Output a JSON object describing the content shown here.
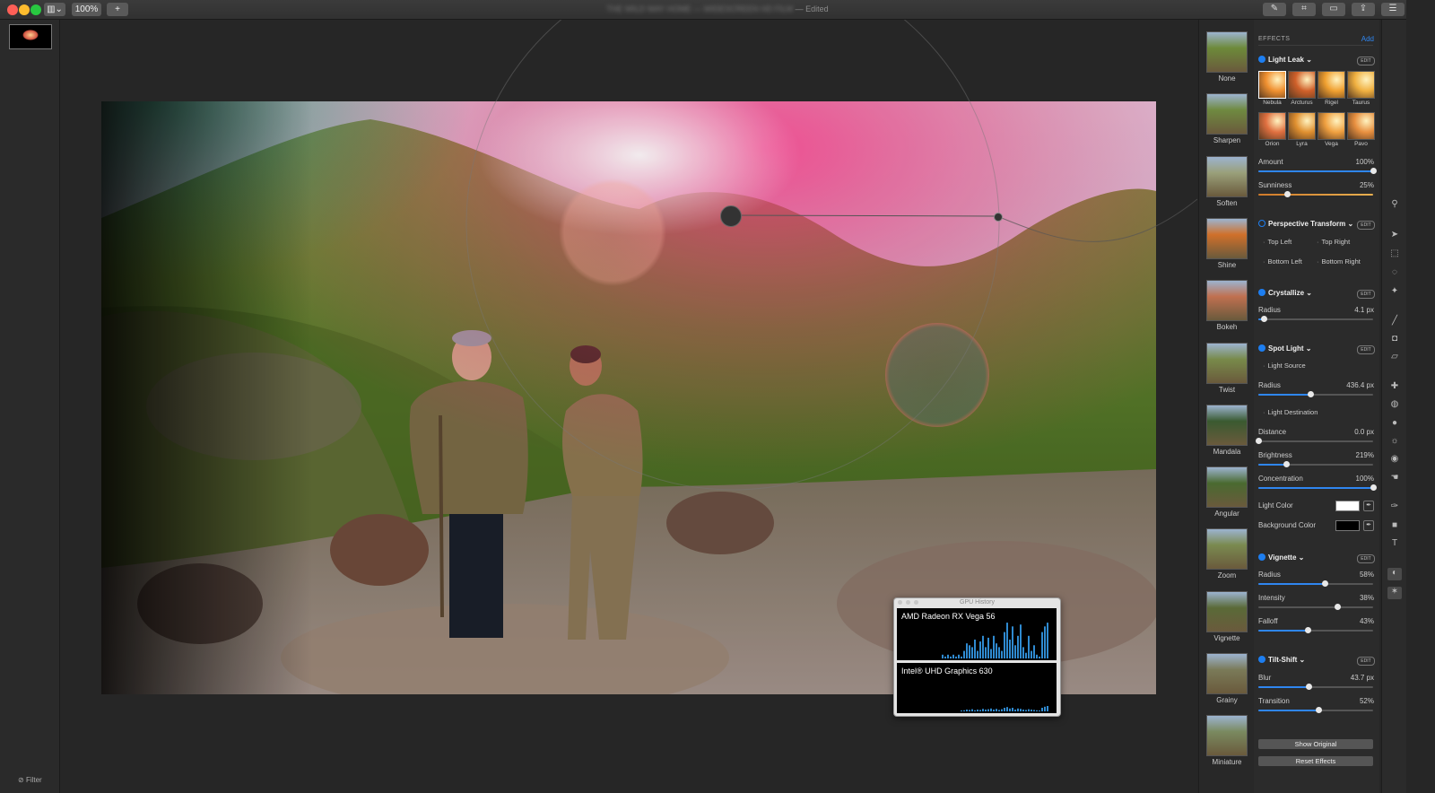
{
  "titlebar": {
    "view_button": "▥⌄",
    "zoom": "100%",
    "add_label": "+",
    "document_title": "THE WILD WAY HOME — WIDESCREEN HD FILM",
    "edited_label": "— Edited"
  },
  "sidebar_left": {
    "filter_label": "Filter"
  },
  "gpu_history": {
    "title": "GPU History",
    "gpus": [
      {
        "name": "AMD Radeon RX Vega 56",
        "bars": [
          0.1,
          0.05,
          0.1,
          0.05,
          0.1,
          0.05,
          0.1,
          0.05,
          0.2,
          0.4,
          0.35,
          0.3,
          0.5,
          0.2,
          0.45,
          0.6,
          0.3,
          0.55,
          0.25,
          0.6,
          0.4,
          0.3,
          0.2,
          0.7,
          0.95,
          0.5,
          0.85,
          0.35,
          0.6,
          0.9,
          0.3,
          0.15,
          0.6,
          0.2,
          0.35,
          0.1,
          0.05,
          0.7,
          0.85,
          0.95
        ]
      },
      {
        "name": "Intel® UHD Graphics 630",
        "bars": [
          0.0,
          0.0,
          0.0,
          0.0,
          0.0,
          0.0,
          0.0,
          0.02,
          0.03,
          0.05,
          0.04,
          0.06,
          0.03,
          0.05,
          0.04,
          0.07,
          0.05,
          0.06,
          0.08,
          0.05,
          0.07,
          0.04,
          0.06,
          0.1,
          0.12,
          0.08,
          0.1,
          0.05,
          0.08,
          0.07,
          0.05,
          0.04,
          0.06,
          0.05,
          0.04,
          0.03,
          0.02,
          0.1,
          0.13,
          0.15
        ]
      }
    ]
  },
  "effect_list": [
    "None",
    "Sharpen",
    "Soften",
    "Shine",
    "Bokeh",
    "Twist",
    "Mandala",
    "Angular",
    "Zoom",
    "Vignette",
    "Grainy",
    "Miniature"
  ],
  "panel": {
    "header": "EFFECTS",
    "add_label": "Add",
    "edit_label": "EDIT",
    "light_leak": {
      "title": "Light Leak",
      "presets": [
        "Nebula",
        "Arcturus",
        "Rigel",
        "Taurus",
        "Orion",
        "Lyra",
        "Vega",
        "Pavo"
      ],
      "amount": {
        "label": "Amount",
        "value": "100%",
        "fraction": 1.0
      },
      "sunniness": {
        "label": "Sunniness",
        "value": "25%",
        "fraction": 0.25
      }
    },
    "perspective": {
      "title": "Perspective Transform",
      "points": [
        "Top Left",
        "Top Right",
        "Bottom Left",
        "Bottom Right"
      ]
    },
    "crystallize": {
      "title": "Crystallize",
      "radius": {
        "label": "Radius",
        "value": "4.1 px",
        "fraction": 0.05
      }
    },
    "spot_light": {
      "title": "Spot Light",
      "light_source": "Light Source",
      "radius": {
        "label": "Radius",
        "value": "436.4 px",
        "fraction": 0.45
      },
      "light_destination": "Light Destination",
      "distance": {
        "label": "Distance",
        "value": "0.0 px",
        "fraction": 0.0
      },
      "brightness": {
        "label": "Brightness",
        "value": "219%",
        "fraction": 0.24
      },
      "concentration": {
        "label": "Concentration",
        "value": "100%",
        "fraction": 1.0
      },
      "light_color": {
        "label": "Light Color",
        "color": "#ffffff"
      },
      "background_color": {
        "label": "Background Color",
        "color": "#000000"
      }
    },
    "vignette": {
      "title": "Vignette",
      "radius": {
        "label": "Radius",
        "value": "58%",
        "fraction": 0.58
      },
      "intensity": {
        "label": "Intensity",
        "value": "38%",
        "fraction": 0.69
      },
      "falloff": {
        "label": "Falloff",
        "value": "43%",
        "fraction": 0.43
      }
    },
    "tilt_shift": {
      "title": "Tilt-Shift",
      "blur": {
        "label": "Blur",
        "value": "43.7 px",
        "fraction": 0.44
      },
      "transition": {
        "label": "Transition",
        "value": "52%",
        "fraction": 0.52
      }
    },
    "show_original": "Show Original",
    "reset_effects": "Reset Effects"
  },
  "colors": {
    "accent": "#2f86f0",
    "panel_bg": "#2b2b2b",
    "canvas_bg": "#262626"
  }
}
